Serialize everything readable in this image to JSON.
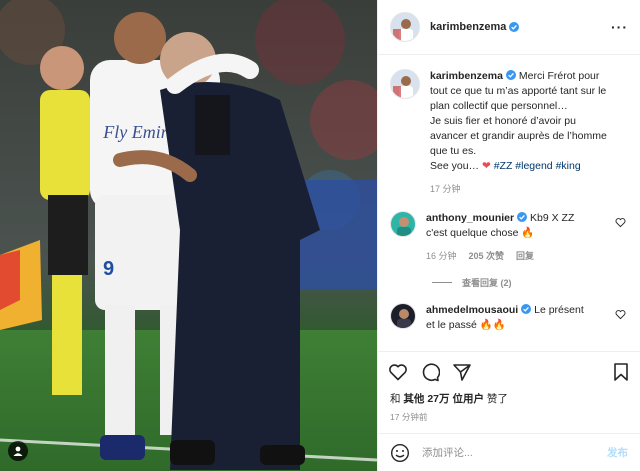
{
  "post": {
    "author": "karimbenzema",
    "caption_lines": [
      "Merci Frérot pour",
      "tout ce que tu m’as apporté tant sur le",
      "plan collectif que personnel…",
      "Je suis fier et honoré d’avoir pu",
      "avancer et grandir auprès de l’homme",
      "que tu es.",
      "See you… "
    ],
    "caption_emoji": "❤",
    "hashtags": [
      "#ZZ",
      "#legend",
      "#king"
    ],
    "caption_time": "17 分钟"
  },
  "comments": [
    {
      "user": "anthony_mounier",
      "text_line1": "Kb9 X ZZ",
      "text_line2": "c'est quelque chose 🔥",
      "time": "16 分钟",
      "likes": "205 次赞",
      "reply": "回复",
      "view_replies": "查看回复 (2)"
    },
    {
      "user": "ahmedelmousaoui",
      "text_line1": "Le présent",
      "text_line2": "et le passé 🔥🔥"
    }
  ],
  "likes": {
    "prefix": "和",
    "others": "其他",
    "count": "27万",
    "suffix_bold": "位用户",
    "suffix": "赞了"
  },
  "post_time": "17 分钟前",
  "add_comment": {
    "placeholder": "添加评论...",
    "post_label": "发布"
  },
  "photo": {
    "shirt_text": "Fly Emirates",
    "number": "9"
  }
}
